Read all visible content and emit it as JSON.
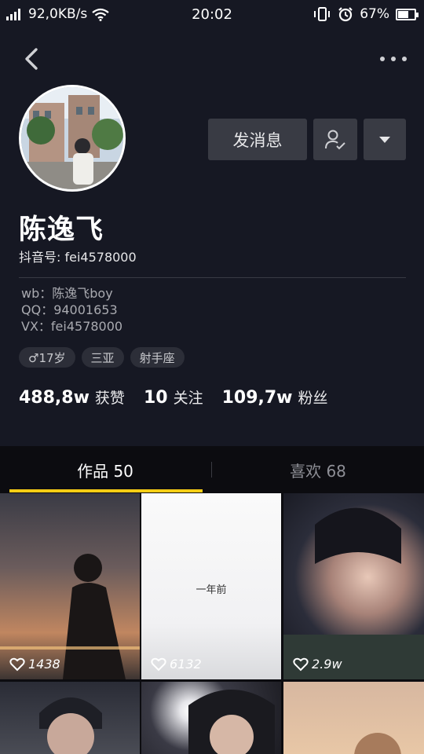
{
  "status_bar": {
    "network_speed": "92,0KB/s",
    "time": "20:02",
    "battery_percent": "67%",
    "battery_level": 0.67
  },
  "profile": {
    "name": "陈逸飞",
    "douyin_id": "抖音号: fei4578000",
    "bio": [
      "wb：陈逸飞boy",
      "QQ：94001653",
      "VX：fei4578000"
    ],
    "tags": [
      "♂17岁",
      "三亚",
      "射手座"
    ]
  },
  "actions": {
    "message_label": "发消息"
  },
  "stats": [
    {
      "value": "488,8w",
      "label": "获赞"
    },
    {
      "value": "10",
      "label": "关注"
    },
    {
      "value": "109,7w",
      "label": "粉丝"
    }
  ],
  "tabs": {
    "works": "作品 50",
    "likes": "喜欢 68"
  },
  "videos": [
    {
      "likes": "1438"
    },
    {
      "likes": "6132",
      "caption": "一年前"
    },
    {
      "likes": "2.9w"
    }
  ],
  "colors": {
    "background": "#161823",
    "accent": "#face15",
    "button": "#393b44"
  }
}
